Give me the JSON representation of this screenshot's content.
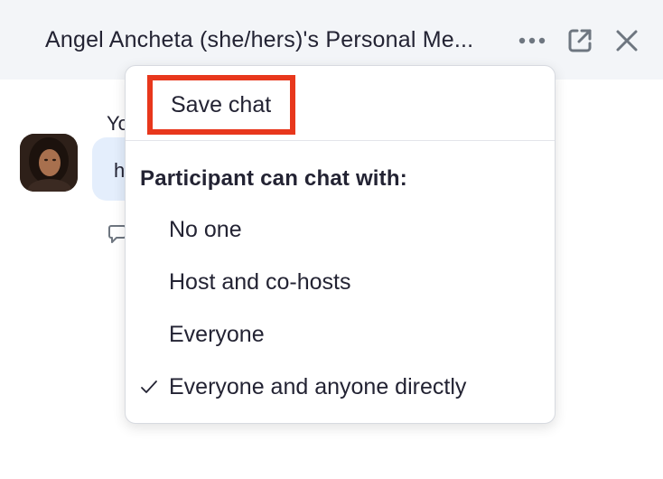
{
  "header": {
    "title": "Angel Ancheta (she/hers)'s Personal Me...",
    "icons": [
      "more-icon",
      "popout-icon",
      "close-icon"
    ]
  },
  "chat": {
    "sender_partial": "Yo",
    "message_partial": "h"
  },
  "menu": {
    "save_chat_label": "Save chat",
    "section_heading": "Participant can chat with:",
    "options": [
      {
        "label": "No one",
        "checked": false
      },
      {
        "label": "Host and co-hosts",
        "checked": false
      },
      {
        "label": "Everyone",
        "checked": false
      },
      {
        "label": "Everyone and anyone directly",
        "checked": true
      }
    ]
  },
  "colors": {
    "highlight_border": "#e8371c",
    "header_bg": "#f3f5f8",
    "bubble_bg": "#e4eefc"
  }
}
